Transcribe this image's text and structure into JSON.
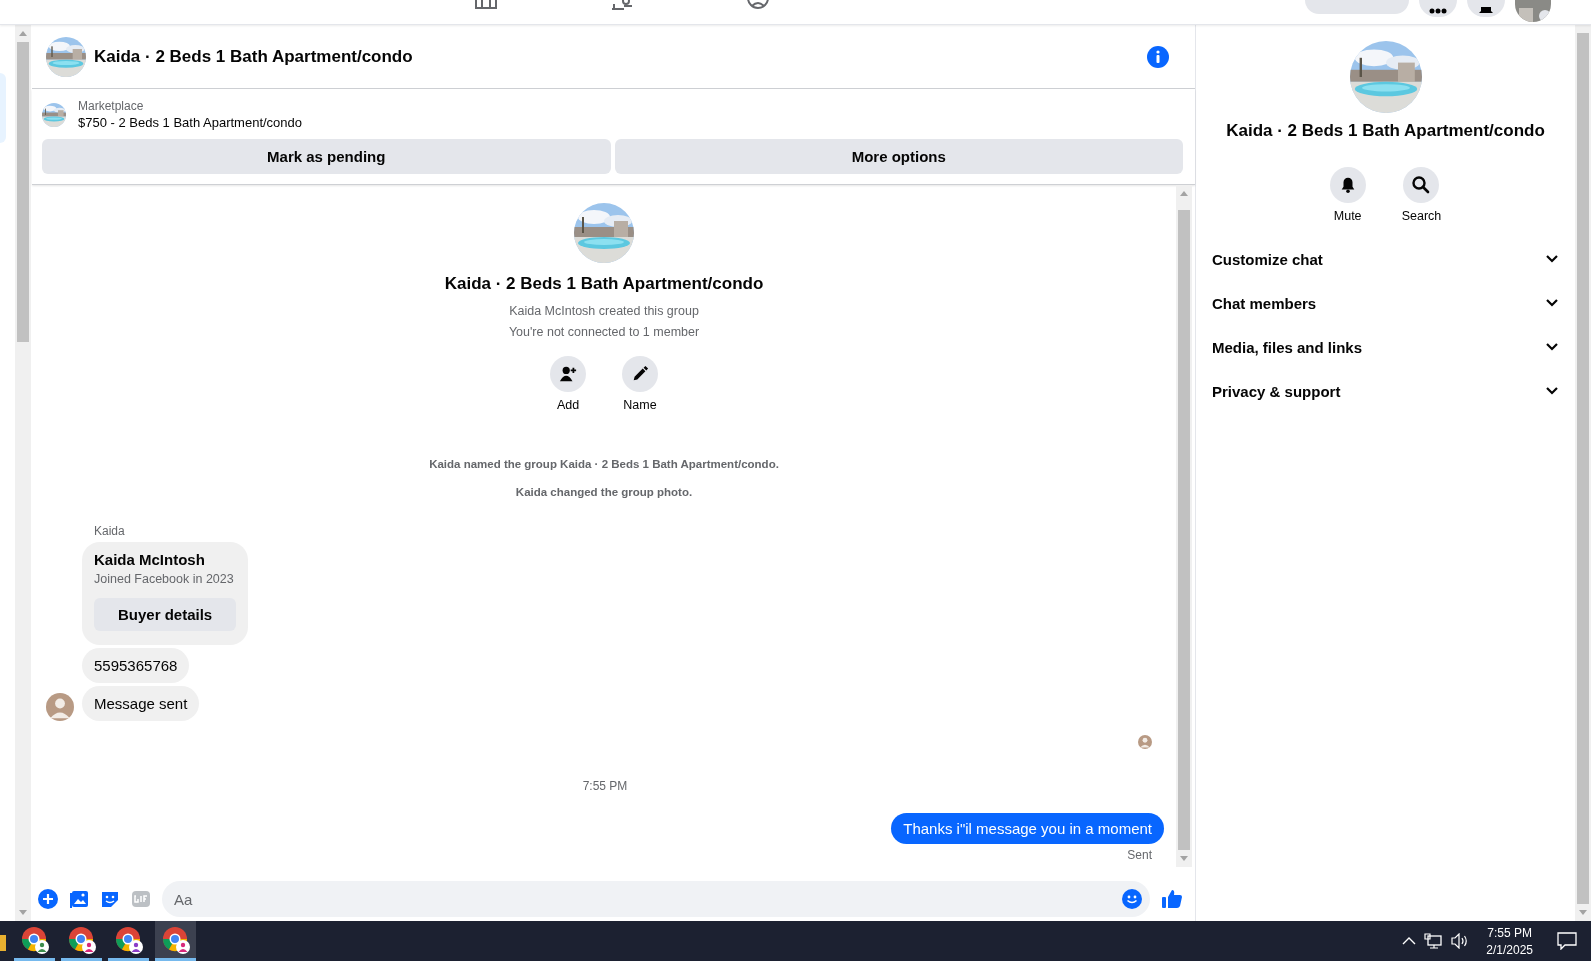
{
  "conversation": {
    "title": "Kaida · 2 Beds 1 Bath Apartment/condo"
  },
  "listing": {
    "source": "Marketplace",
    "summary": "$750 - 2 Beds 1 Bath Apartment/condo",
    "actions": [
      "Mark as pending",
      "More options"
    ]
  },
  "intro": {
    "title": "Kaida · 2 Beds 1 Bath Apartment/condo",
    "lines": [
      "Kaida McIntosh created this group",
      "You're not connected to 1 member"
    ],
    "actions": [
      {
        "label": "Add",
        "kind": "add-person"
      },
      {
        "label": "Name",
        "kind": "pencil"
      }
    ]
  },
  "events": [
    "Kaida named the group Kaida · 2 Beds 1 Bath Apartment/condo.",
    "Kaida changed the group photo."
  ],
  "messages": [
    {
      "kind": "sender_label",
      "text": "Kaida"
    },
    {
      "kind": "profile_card",
      "name": "Kaida McIntosh",
      "detail": "Joined Facebook in 2023",
      "button": "Buyer details"
    },
    {
      "kind": "incoming",
      "text": "5595365768",
      "avatar": false
    },
    {
      "kind": "incoming",
      "text": "Message sent",
      "avatar": true
    },
    {
      "kind": "read_receipt"
    },
    {
      "kind": "timestamp",
      "text": "7:55 PM"
    },
    {
      "kind": "outgoing",
      "text": "Thanks i\"il message you in a moment",
      "status": "Sent"
    }
  ],
  "composer": {
    "placeholder": "Aa"
  },
  "details": {
    "title": "Kaida · 2 Beds 1 Bath Apartment/condo",
    "actions": [
      {
        "label": "Mute",
        "kind": "bell"
      },
      {
        "label": "Search",
        "kind": "search"
      }
    ],
    "sections": [
      {
        "label": "Customize chat",
        "expanded": false
      },
      {
        "label": "Chat members",
        "expanded": false
      },
      {
        "label": "Media, files and links",
        "expanded": false
      },
      {
        "label": "Privacy & support",
        "expanded": false
      }
    ]
  },
  "taskbar": {
    "apps": [
      {
        "color": "#3c8c4c",
        "selected": false
      },
      {
        "color": "#d8287a",
        "selected": false
      },
      {
        "color": "#8a3cc8",
        "selected": false
      },
      {
        "color": "#d8287a",
        "selected": true
      }
    ],
    "time": "7:55 PM",
    "date": "2/1/2025"
  }
}
